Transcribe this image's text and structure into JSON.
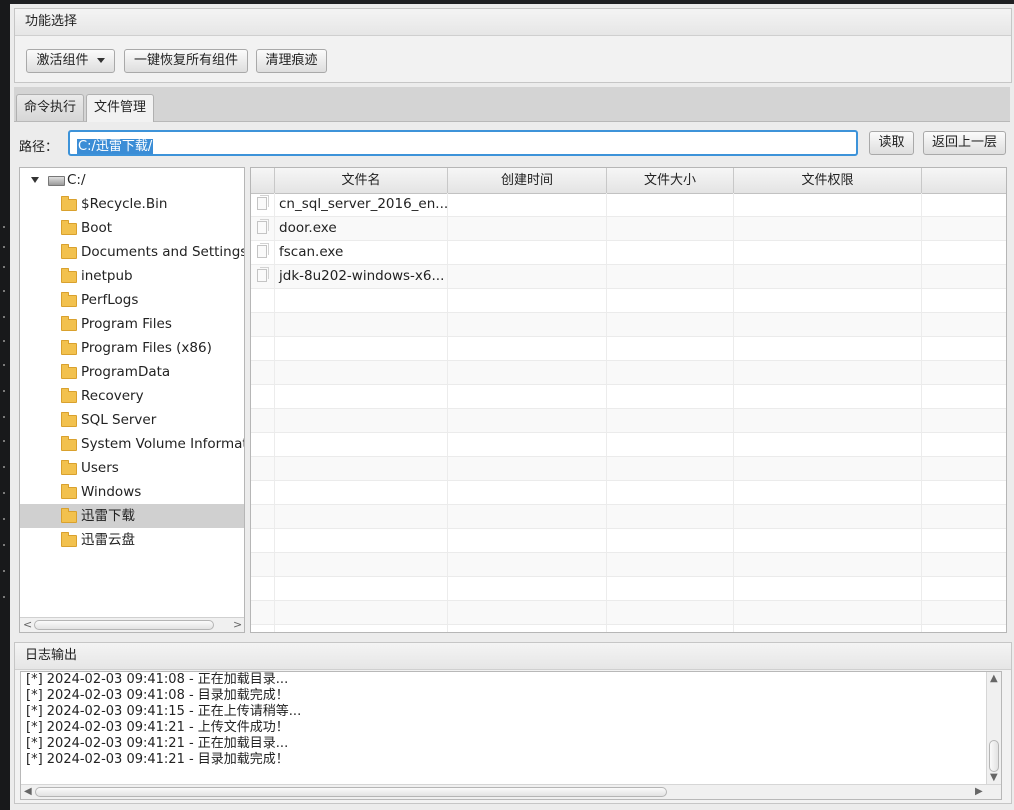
{
  "function_panel": {
    "title": "功能选择",
    "activate_label": "激活组件",
    "restore_label": "一键恢复所有组件",
    "clean_label": "清理痕迹"
  },
  "tabs": [
    {
      "label": "命令执行",
      "active": false
    },
    {
      "label": "文件管理",
      "active": true
    }
  ],
  "path_bar": {
    "label": "路径：",
    "value": "C:/迅雷下载/",
    "read_label": "读取",
    "back_label": "返回上一层"
  },
  "tree": {
    "root": "C:/",
    "items": [
      {
        "label": "$Recycle.Bin"
      },
      {
        "label": "Boot"
      },
      {
        "label": "Documents and Settings"
      },
      {
        "label": "inetpub"
      },
      {
        "label": "PerfLogs"
      },
      {
        "label": "Program Files"
      },
      {
        "label": "Program Files (x86)"
      },
      {
        "label": "ProgramData"
      },
      {
        "label": "Recovery"
      },
      {
        "label": "SQL Server"
      },
      {
        "label": "System Volume Informat..."
      },
      {
        "label": "Users"
      },
      {
        "label": "Windows"
      },
      {
        "label": "迅雷下载",
        "selected": true
      },
      {
        "label": "迅雷云盘"
      }
    ]
  },
  "file_table": {
    "columns": [
      "文件名",
      "创建时间",
      "文件大小",
      "文件权限"
    ],
    "rows": [
      {
        "name": "cn_sql_server_2016_en...",
        "created": "",
        "size": "",
        "perm": ""
      },
      {
        "name": "door.exe",
        "created": "",
        "size": "",
        "perm": ""
      },
      {
        "name": "fscan.exe",
        "created": "",
        "size": "",
        "perm": ""
      },
      {
        "name": "jdk-8u202-windows-x6...",
        "created": "",
        "size": "",
        "perm": ""
      }
    ]
  },
  "log": {
    "title": "日志输出",
    "lines": [
      "[*] 2024-02-03 09:41:08 - 正在加载目录...",
      "[*] 2024-02-03 09:41:08 - 目录加载完成！",
      "[*] 2024-02-03 09:41:15 - 正在上传请稍等...",
      "[*] 2024-02-03 09:41:21 - 上传文件成功！",
      "[*] 2024-02-03 09:41:21 - 正在加载目录...",
      "[*] 2024-02-03 09:41:21 - 目录加载完成！"
    ]
  },
  "colors": {
    "accent": "#3d93d9",
    "selection": "#d0d0d0",
    "folder": "#f2c14e"
  }
}
